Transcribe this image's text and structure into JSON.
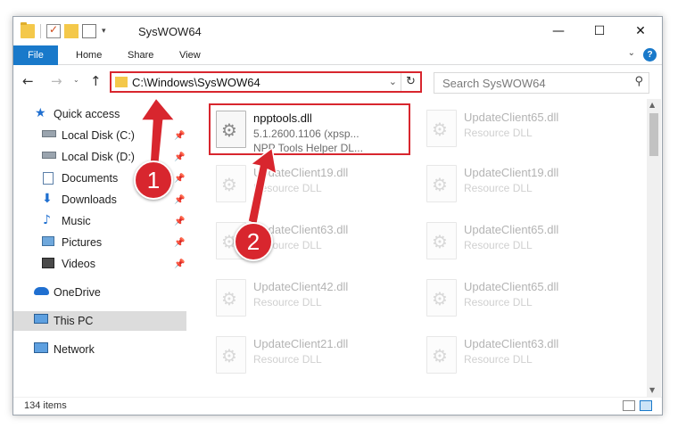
{
  "window": {
    "title": "SysWOW64",
    "controls": {
      "minimize": "—",
      "maximize": "☐",
      "close": "✕"
    }
  },
  "ribbon": {
    "tabs": [
      "File",
      "Home",
      "Share",
      "View"
    ],
    "help": "?"
  },
  "navbar": {
    "back": "←",
    "forward": "→",
    "dropdown": "⌄",
    "up": "↑",
    "address": "C:\\Windows\\SysWOW64",
    "address_chevron": "⌄",
    "refresh": "↻",
    "search_placeholder": "Search SysWOW64",
    "search_icon": "⚲"
  },
  "navpane": {
    "items": [
      {
        "label": "Quick access",
        "icon": "star-icon"
      },
      {
        "label": "Local Disk (C:)",
        "icon": "drive-icon",
        "pinned": true
      },
      {
        "label": "Local Disk (D:)",
        "icon": "drive-icon",
        "pinned": true
      },
      {
        "label": "Documents",
        "icon": "documents-icon",
        "pinned": true
      },
      {
        "label": "Downloads",
        "icon": "downloads-icon",
        "pinned": true
      },
      {
        "label": "Music",
        "icon": "music-icon",
        "pinned": true
      },
      {
        "label": "Pictures",
        "icon": "pictures-icon",
        "pinned": true
      },
      {
        "label": "Videos",
        "icon": "videos-icon",
        "pinned": true
      },
      {
        "label": "OneDrive",
        "icon": "onedrive-icon"
      },
      {
        "label": "This PC",
        "icon": "pc-icon",
        "selected": true
      },
      {
        "label": "Network",
        "icon": "network-icon"
      }
    ]
  },
  "files": {
    "highlighted": {
      "name": "npptools.dll",
      "line2": "5.1.2600.1106 (xpsp...",
      "line3": "NPP Tools Helper DL..."
    },
    "faded": [
      {
        "name": "UpdateClient65.dll",
        "type": "Resource DLL"
      },
      {
        "name": "UpdateClient19.dll",
        "type": "Resource DLL"
      },
      {
        "name": "UpdateClient19.dll",
        "type": "Resource DLL"
      },
      {
        "name": "UpdateClient63.dll",
        "type": "Resource DLL"
      },
      {
        "name": "UpdateClient65.dll",
        "type": "Resource DLL"
      },
      {
        "name": "UpdateClient42.dll",
        "type": "Resource DLL"
      },
      {
        "name": "UpdateClient65.dll",
        "type": "Resource DLL"
      },
      {
        "name": "UpdateClient21.dll",
        "type": "Resource DLL"
      },
      {
        "name": "UpdateClient63.dll",
        "type": "Resource DLL"
      }
    ]
  },
  "status": {
    "item_count": "134 items"
  },
  "callouts": [
    "1",
    "2"
  ],
  "colors": {
    "accent": "#1979ca",
    "highlight": "#d8262e"
  }
}
